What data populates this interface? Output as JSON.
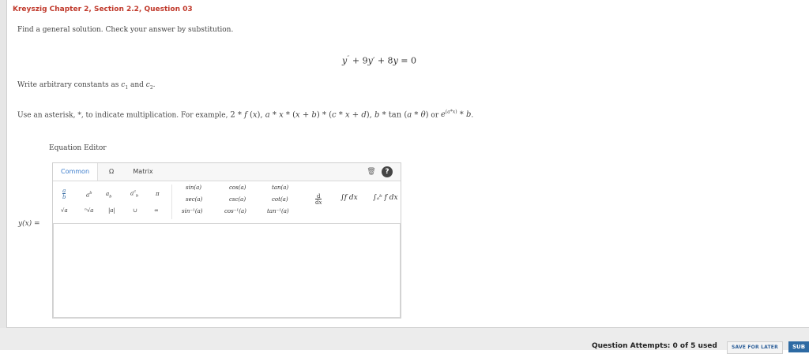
{
  "question": {
    "title": "Kreyszig Chapter 2, Section 2.2, Question 03",
    "prompt": "Find a general solution. Check your answer by substitution.",
    "equation": "y'' + 9y' + 8y = 0",
    "constants_note": "Write arbitrary constants as c1 and c2.",
    "multiplication_note": "Use an asterisk, *, to indicate multiplication. For example, 2 * f(x), a * x * (x + b) * (c * x + d), b * tan(a * θ) or e^(a*x) * b."
  },
  "editor": {
    "label": "Equation Editor",
    "tabs": [
      "Common",
      "Ω",
      "Matrix"
    ],
    "answer_label": "y(x) =",
    "answer_value": "",
    "palette": {
      "fraction": "a/b",
      "power": "a^b",
      "subscript": "a_b",
      "subsup": "a_b^c",
      "pi": "π",
      "sqrt": "√a",
      "nthroot": "ⁿ√a",
      "abs": "|a|",
      "union": "∪",
      "infinity": "∞",
      "sin": "sin(a)",
      "sec": "sec(a)",
      "arcsin": "sin⁻¹(a)",
      "cos": "cos(a)",
      "csc": "csc(a)",
      "arccos": "cos⁻¹(a)",
      "tan": "tan(a)",
      "cot": "cot(a)",
      "arctan": "tan⁻¹(a)",
      "derivative": "d/dx",
      "integral": "∫f dx",
      "definite_integral": "∫ₐᵇ f dx"
    }
  },
  "footer": {
    "attempts": "Question Attempts: 0 of 5 used",
    "save_label": "SAVE FOR LATER",
    "submit_label": "SUB"
  }
}
